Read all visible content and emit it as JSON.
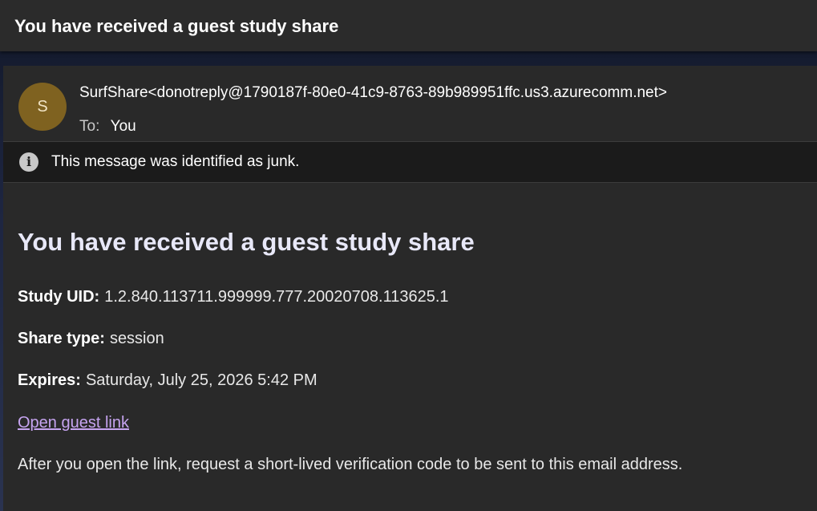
{
  "subject": "You have received a guest study share",
  "sender": {
    "avatar_initial": "S",
    "display": "SurfShare<donotreply@1790187f-80e0-41c9-8763-89b989951ffc.us3.azurecomm.net>",
    "to_label": "To:",
    "to_value": "You"
  },
  "junk_notice": {
    "icon": "info-icon",
    "text": "This message was identified as junk."
  },
  "body": {
    "heading": "You have received a guest study share",
    "fields": [
      {
        "label": "Study UID:",
        "value": "1.2.840.113711.999999.777.20020708.113625.1"
      },
      {
        "label": "Share type:",
        "value": "session"
      },
      {
        "label": "Expires:",
        "value": "Saturday, July 25, 2026 5:42 PM"
      }
    ],
    "link_text": "Open guest link",
    "note": "After you open the link, request a short-lived verification code to be sent to this email address."
  },
  "colors": {
    "avatar_bg": "#7f6220",
    "link": "#c6a4f0",
    "card_bg": "#292929",
    "junk_bar_bg": "#1b1b1b"
  }
}
